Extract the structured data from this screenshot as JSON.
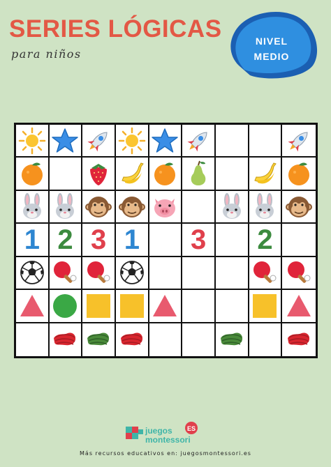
{
  "header": {
    "title": "SERIES LÓGICAS",
    "subtitle": "para niños"
  },
  "badge": {
    "line1": "NIVEL",
    "line2": "MEDIO"
  },
  "grid": {
    "rows": [
      [
        "sun",
        "star",
        "rocket",
        "sun",
        "star",
        "rocket",
        "",
        "",
        "rocket"
      ],
      [
        "orange",
        "",
        "strawberry",
        "banana",
        "orange",
        "pear",
        "",
        "banana",
        "orange"
      ],
      [
        "rabbit",
        "rabbit",
        "monkey",
        "monkey",
        "pig",
        "",
        "rabbit",
        "rabbit",
        "monkey"
      ],
      [
        "1",
        "2",
        "3",
        "1",
        "",
        "3",
        "",
        "2",
        ""
      ],
      [
        "soccer",
        "pingpong",
        "pingpong",
        "soccer",
        "",
        "",
        "",
        "pingpong",
        "pingpong"
      ],
      [
        "triangle",
        "circle",
        "square",
        "square",
        "triangle",
        "",
        "",
        "square",
        "triangle"
      ],
      [
        "",
        "red-scribble",
        "green-scribble",
        "red-scribble",
        "",
        "",
        "green-scribble",
        "",
        "red-scribble"
      ]
    ],
    "number_colors": {
      "1": "#2e86d1",
      "2": "#3c8b3f",
      "3": "#e0404c"
    }
  },
  "footer": {
    "logo_line1": "juegos",
    "logo_line2": "montessori",
    "logo_badge": "ES",
    "text": "Más recursos educativos en: juegosmontessori.es"
  },
  "colors": {
    "background": "#cfe3c4",
    "title": "#e35845",
    "badge": "#2f8fe0"
  }
}
